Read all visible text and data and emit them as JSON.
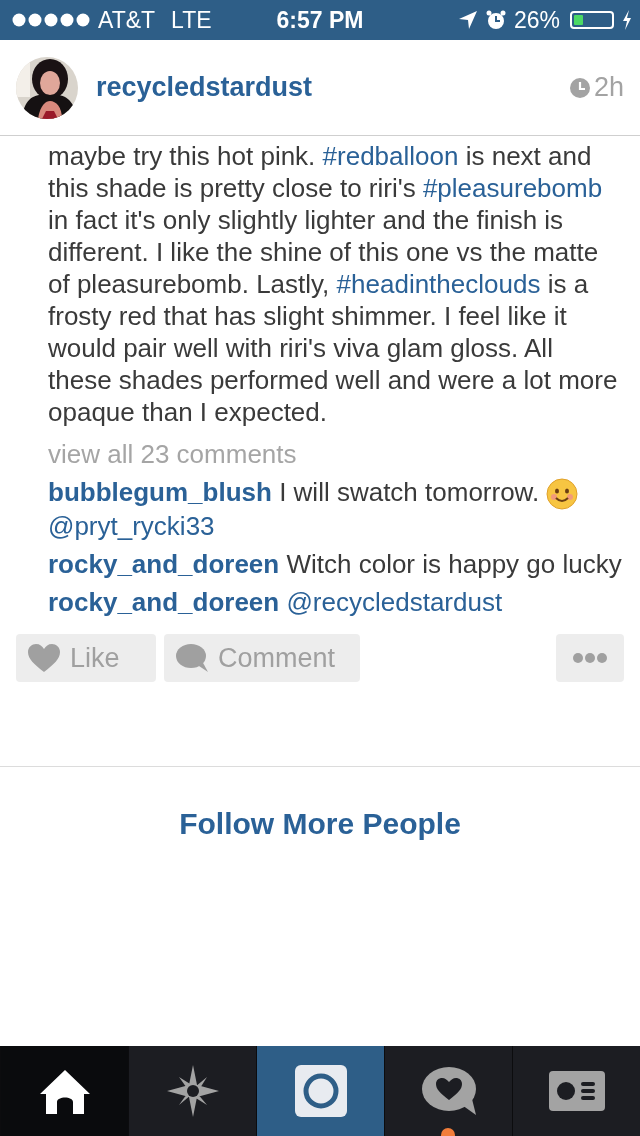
{
  "status_bar": {
    "carrier": "AT&T",
    "network": "LTE",
    "time": "6:57 PM",
    "battery": "26%"
  },
  "post": {
    "username": "recycledstardust",
    "time": "2h",
    "caption": [
      {
        "kind": "text",
        "text": "maybe try this hot pink. "
      },
      {
        "kind": "tag",
        "text": "#redballoon"
      },
      {
        "kind": "text",
        "text": " is next and this shade is pretty close to riri's "
      },
      {
        "kind": "tag",
        "text": "#pleasurebomb"
      },
      {
        "kind": "text",
        "text": " in fact it's only slightly lighter and the finish is different. I like the shine of this one vs the matte of pleasurebomb. Lastly, "
      },
      {
        "kind": "tag",
        "text": "#headintheclouds"
      },
      {
        "kind": "text",
        "text": " is a frosty red that has slight shimmer. I feel like it would pair well with riri's viva glam gloss. All these shades performed well and were a lot more opaque than I expected."
      }
    ],
    "view_all": "view all 23 comments",
    "comments": [
      {
        "user": "bubblegum_blush",
        "text": "I will swatch tomorrow.",
        "emoji": true,
        "mention": "@pryt_rycki33"
      },
      {
        "user": "rocky_and_doreen",
        "text": "Witch color is happy go lucky"
      },
      {
        "user": "rocky_and_doreen",
        "mention": "@recycledstardust"
      }
    ],
    "actions": {
      "like": "Like",
      "comment": "Comment"
    }
  },
  "follow_more": "Follow More People",
  "tabs": [
    {
      "kind": "home",
      "selected": true
    },
    {
      "kind": "explore",
      "selected": false
    },
    {
      "kind": "camera",
      "selected": false
    },
    {
      "kind": "activity",
      "selected": false,
      "notification": true
    },
    {
      "kind": "profile",
      "selected": false
    }
  ]
}
